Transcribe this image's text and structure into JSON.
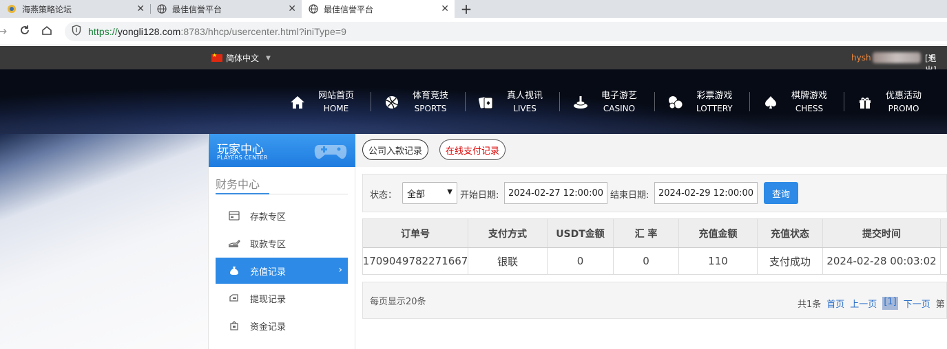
{
  "browser": {
    "tabs": [
      {
        "title": "海燕策略论坛",
        "active": false
      },
      {
        "title": "最佳信誉平台",
        "active": false
      },
      {
        "title": "最佳信誉平台",
        "active": true
      }
    ],
    "url": {
      "proto": "https://",
      "host": "yongli128.com",
      "rest": ":8783/hhcp/usercenter.html?iniType=9"
    }
  },
  "topbar": {
    "language": "简体中文",
    "username": "hysh",
    "logout": "[退出]"
  },
  "nav": [
    {
      "zh": "网站首页",
      "en": "HOME",
      "icon": "home-icon"
    },
    {
      "zh": "体育竞技",
      "en": "SPORTS",
      "icon": "basketball-icon"
    },
    {
      "zh": "真人视讯",
      "en": "LIVES",
      "icon": "cards-icon"
    },
    {
      "zh": "电子游艺",
      "en": "CASINO",
      "icon": "slot-icon"
    },
    {
      "zh": "彩票游戏",
      "en": "LOTTERY",
      "icon": "lottery-balls-icon"
    },
    {
      "zh": "棋牌游戏",
      "en": "CHESS",
      "icon": "spade-icon"
    },
    {
      "zh": "优惠活动",
      "en": "PROMO",
      "icon": "gift-icon"
    }
  ],
  "sidebar": {
    "header_title": "玩家中心",
    "header_sub": "PLAYERS CENTER",
    "section_title": "财务中心",
    "items": [
      {
        "label": "存款专区",
        "icon": "deposit-icon",
        "active": false
      },
      {
        "label": "取款专区",
        "icon": "withdraw-icon",
        "active": false
      },
      {
        "label": "充值记录",
        "icon": "moneybag-icon",
        "active": true
      },
      {
        "label": "提现记录",
        "icon": "withdraw-record-icon",
        "active": false
      },
      {
        "label": "资金记录",
        "icon": "funds-icon",
        "active": false
      }
    ]
  },
  "main": {
    "tabs": [
      "公司入款记录",
      "在线支付记录"
    ],
    "filter": {
      "status_label": "状态：",
      "status_value": "全部",
      "start_label": "开始日期:",
      "start_value": "2024-02-27 12:00:00",
      "end_label": "结束日期:",
      "end_value": "2024-02-29 12:00:00",
      "query_button": "查询"
    },
    "table": {
      "headers": [
        "订单号",
        "支付方式",
        "USDT金额",
        "汇 率",
        "充值金额",
        "充值状态",
        "提交时间"
      ],
      "rows": [
        [
          "1709049782271667",
          "银联",
          "0",
          "0",
          "110",
          "支付成功",
          "2024-02-28 00:03:02"
        ]
      ]
    },
    "pager": {
      "per_page": "每页显示20条",
      "total": "共1条",
      "first": "首页",
      "prev": "上一页",
      "current": "[1]",
      "next": "下一页",
      "tail": "第"
    }
  },
  "colors": {
    "accent": "#2d8ae6",
    "brand_header": "#1f7ce0",
    "topbar": "#3a3a3a",
    "username": "#f0883e",
    "success_link": "#2b6fc9"
  }
}
